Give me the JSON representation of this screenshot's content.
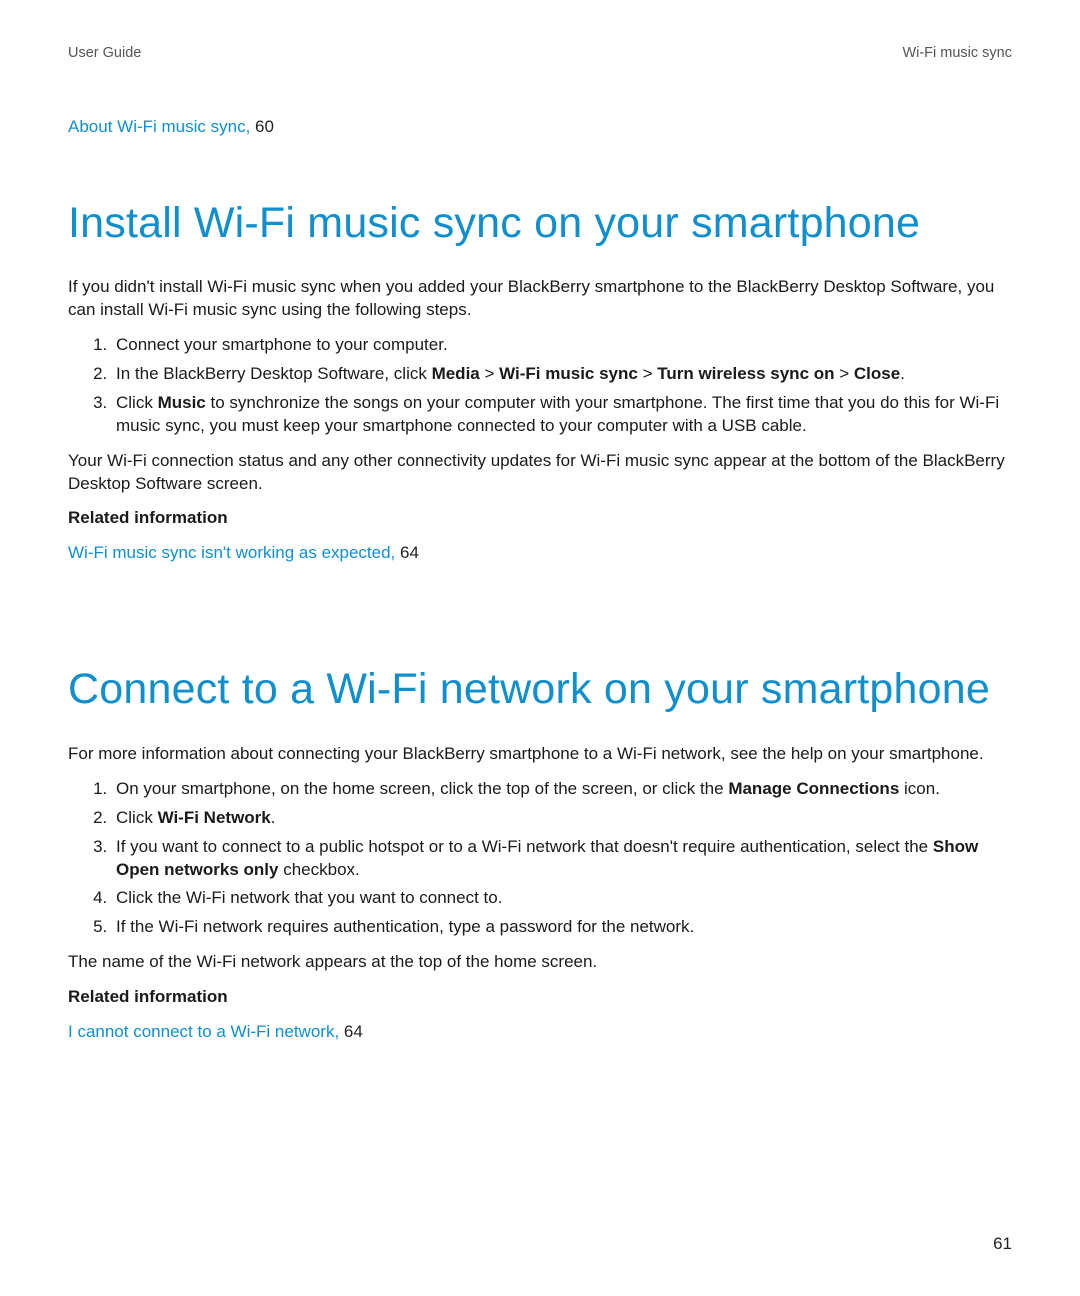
{
  "header": {
    "left": "User Guide",
    "right": "Wi-Fi music sync"
  },
  "top_xref": {
    "text": "About Wi-Fi music sync,",
    "page": " 60"
  },
  "section1": {
    "title": "Install Wi-Fi music sync on your smartphone",
    "intro": "If you didn't install Wi-Fi music sync when you added your BlackBerry smartphone to the BlackBerry Desktop Software, you can install Wi-Fi music sync using the following steps.",
    "steps": {
      "s1": "Connect your smartphone to your computer.",
      "s2_pre": "In the BlackBerry Desktop Software, click ",
      "s2_b1": "Media",
      "s2_sep": " > ",
      "s2_b2": "Wi-Fi music sync",
      "s2_b3": "Turn wireless sync on",
      "s2_b4": "Close",
      "s2_dot": ".",
      "s3_pre": "Click ",
      "s3_b1": "Music",
      "s3_post": " to synchronize the songs on your computer with your smartphone. The first time that you do this for Wi-Fi music sync, you must keep your smartphone connected to your computer with a USB cable."
    },
    "para2": "Your Wi-Fi connection status and any other connectivity updates for Wi-Fi music sync appear at the bottom of the BlackBerry Desktop Software screen.",
    "related_label": "Related information",
    "related_link": "Wi-Fi music sync isn't working as expected,",
    "related_page": " 64"
  },
  "section2": {
    "title": "Connect to a Wi-Fi network on your smartphone",
    "intro": "For more information about connecting your BlackBerry smartphone to a Wi-Fi network, see the help on your smartphone.",
    "steps": {
      "s1_pre": "On your smartphone, on the home screen, click the top of the screen, or click the ",
      "s1_b1": "Manage Connections",
      "s1_post": " icon.",
      "s2_pre": "Click ",
      "s2_b1": "Wi-Fi Network",
      "s2_post": ".",
      "s3_pre": "If you want to connect to a public hotspot or to a Wi-Fi network that doesn't require authentication, select the ",
      "s3_b1": "Show Open networks only",
      "s3_post": " checkbox.",
      "s4": "Click the Wi-Fi network that you want to connect to.",
      "s5": "If the Wi-Fi network requires authentication, type a password for the network."
    },
    "para2": "The name of the Wi-Fi network appears at the top of the home screen.",
    "related_label": "Related information",
    "related_link": "I cannot connect to a Wi-Fi network,",
    "related_page": " 64"
  },
  "page_number": "61"
}
